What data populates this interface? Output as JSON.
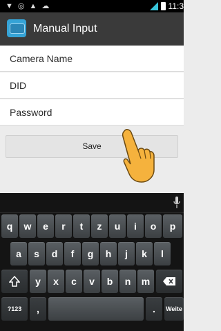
{
  "status_bar": {
    "time": "11:3",
    "left_icons": [
      "pin-icon",
      "sync-icon",
      "alert-icon",
      "cloud-icon"
    ],
    "right_icons": [
      "signal-icon",
      "battery-icon"
    ]
  },
  "app": {
    "title": "Manual Input",
    "icon": "camera-app-icon"
  },
  "form": {
    "camera_name_placeholder": "Camera Name",
    "did_placeholder": "DID",
    "password_placeholder": "Password",
    "save_label": "Save"
  },
  "keyboard": {
    "row1": [
      "q",
      "w",
      "e",
      "r",
      "t",
      "z",
      "u",
      "i",
      "o",
      "p"
    ],
    "row2": [
      "a",
      "s",
      "d",
      "f",
      "g",
      "h",
      "j",
      "k",
      "l"
    ],
    "row3": [
      "y",
      "x",
      "c",
      "v",
      "b",
      "n",
      "m"
    ],
    "shift_icon": "shift-icon",
    "backspace_icon": "backspace-icon",
    "symbols_label": "?123",
    "comma_label": ",",
    "space_label": "",
    "period_label": ".",
    "enter_label": "Weite",
    "mic_icon": "microphone-icon"
  },
  "colors": {
    "action_bar": "#3a3a3a",
    "status_bar": "#000000",
    "background": "#ececec",
    "keyboard": "#141414",
    "hand": "#f5b23d"
  }
}
